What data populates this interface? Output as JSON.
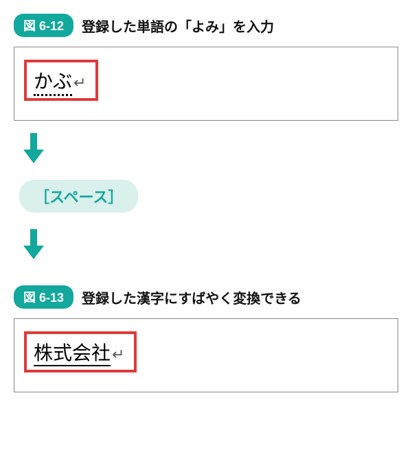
{
  "figure1": {
    "badge": "図 6-12",
    "caption": "登録した単語の「よみ」を入力",
    "inputText": "かぶ",
    "returnSymbol": "↵"
  },
  "keyLabel": "［スペース］",
  "figure2": {
    "badge": "図 6-13",
    "caption": "登録した漢字にすばやく変換できる",
    "inputText": "株式会社",
    "returnSymbol": "↵"
  },
  "arrowColor": "#12a89d"
}
